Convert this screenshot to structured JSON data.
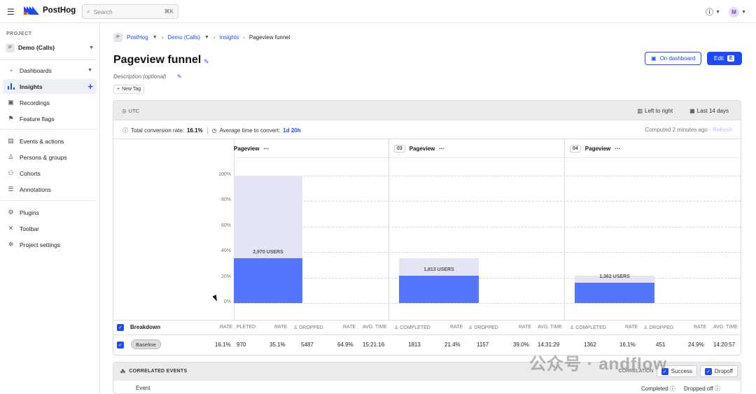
{
  "app": {
    "logo_name": "PostHog",
    "search_placeholder": "Search",
    "search_shortcut": "⌘K",
    "avatar_letter": "M",
    "help_icon": "help-circle-icon",
    "accent": "#1d4aff"
  },
  "sidebar": {
    "project_label": "PROJECT",
    "project_badge": "P",
    "project_name": "Demo (Calls)",
    "items": [
      {
        "label": "Dashboards",
        "icon": "dashboard-icon"
      },
      {
        "label": "Insights",
        "icon": "insights-icon"
      },
      {
        "label": "Recordings",
        "icon": "recordings-icon"
      },
      {
        "label": "Feature flags",
        "icon": "flag-icon"
      },
      {
        "label": "Events & actions",
        "icon": "events-icon"
      },
      {
        "label": "Persons & groups",
        "icon": "person-icon"
      },
      {
        "label": "Cohorts",
        "icon": "cohorts-icon"
      },
      {
        "label": "Annotations",
        "icon": "annotations-icon"
      },
      {
        "label": "Plugins",
        "icon": "plugins-icon"
      },
      {
        "label": "Toolbar",
        "icon": "toolbar-icon"
      },
      {
        "label": "Project settings",
        "icon": "settings-icon"
      }
    ]
  },
  "breadcrumb": {
    "badge": "P",
    "org": "PostHog",
    "project": "Demo (Calls)",
    "section": "Insights",
    "current": "Pageview funnel"
  },
  "page": {
    "title": "Pageview funnel",
    "description_placeholder": "Description (optional)",
    "new_tag": "New Tag",
    "on_dashboard": "On dashboard",
    "edit": "Edit",
    "edit_kbd": "E"
  },
  "panel": {
    "timezone": "UTC",
    "layout": "Left to right",
    "date_range": "Last 14 days",
    "total_conversion_label": "Total conversion rate:",
    "total_conversion_value": "16.1%",
    "avg_time_label": "Average time to convert:",
    "avg_time_value": "1d 20h",
    "computed": "Computed 2 minutes ago",
    "refresh": "Refresh"
  },
  "chart_data": {
    "type": "bar",
    "ylim": [
      0,
      100
    ],
    "yticks": [
      "100%",
      "80%",
      "60%",
      "40%",
      "20%",
      "0%"
    ],
    "steps": [
      {
        "num": "",
        "name": "Pageview",
        "users_label": "2,970 USERS",
        "conversion_pct": 35.1,
        "baseline_pct": 100
      },
      {
        "num": "03",
        "name": "Pageview",
        "users_label": "1,813 USERS",
        "conversion_pct": 21.4,
        "baseline_pct": 35.1
      },
      {
        "num": "04",
        "name": "Pageview",
        "users_label": "1,362 USERS",
        "conversion_pct": 16.1,
        "baseline_pct": 21.4
      }
    ]
  },
  "table": {
    "breakdown_label": "Breakdown",
    "rate_label": "RATE",
    "headers_step1": [
      "PLETED",
      "RATE",
      "DROPPED",
      "RATE",
      "AVG. TIME"
    ],
    "headers_step": [
      "COMPLETED",
      "RATE",
      "DROPPED",
      "RATE",
      "AVG. TIME"
    ],
    "row": {
      "name": "Baseline",
      "rate": "16.1%",
      "step1": [
        "970",
        "35.1%",
        "5487",
        "64.9%",
        "15:21:16"
      ],
      "step2": [
        "1813",
        "21.4%",
        "1157",
        "39.0%",
        "14:31:29"
      ],
      "step3": [
        "1362",
        "16.1%",
        "451",
        "24.9%",
        "14:20:57"
      ]
    }
  },
  "correlated": {
    "title": "CORRELATED EVENTS",
    "correlation_label": "CORRELATION",
    "success": "Success",
    "dropoff": "Dropoff",
    "event_col": "Event",
    "completed_col": "Completed",
    "dropped_col": "Dropped off"
  },
  "watermark": "公众号 · andflow"
}
